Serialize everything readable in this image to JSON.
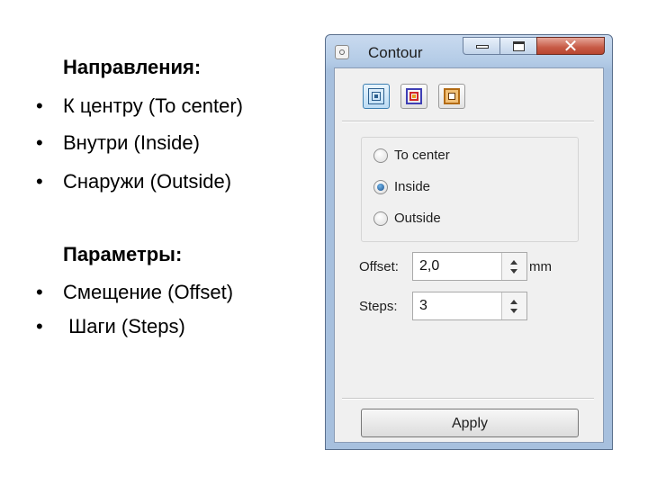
{
  "slide": {
    "directions_heading": "Направления:",
    "directions": [
      "К центру (To center)",
      "Внутри (Inside)",
      "Снаружи (Outside)"
    ],
    "params_heading": "Параметры:",
    "params": [
      "Смещение (Offset)",
      " Шаги (Steps)"
    ],
    "bullet_glyph": "•"
  },
  "dialog": {
    "title": "Contour",
    "title_icon": "contour-docker-icon",
    "caption_buttons": {
      "minimize": "minimize-icon",
      "maximize": "maximize-icon",
      "close": "✕"
    },
    "modes": [
      {
        "name": "to-center-mode",
        "selected": true
      },
      {
        "name": "inside-mode",
        "selected": false
      },
      {
        "name": "outside-mode",
        "selected": false
      }
    ],
    "direction_options": [
      {
        "label": "To center",
        "checked": false
      },
      {
        "label": "Inside",
        "checked": true
      },
      {
        "label": "Outside",
        "checked": false
      }
    ],
    "offset": {
      "label": "Offset:",
      "value": "2,0",
      "unit": "mm"
    },
    "steps": {
      "label": "Steps:",
      "value": "3"
    },
    "apply_label": "Apply"
  },
  "colors": {
    "window_frame": "#a7c0de",
    "close_button": "#c75a45",
    "selected_mode": "#bcdcf4",
    "radio_checked": "#1b4f8a"
  }
}
